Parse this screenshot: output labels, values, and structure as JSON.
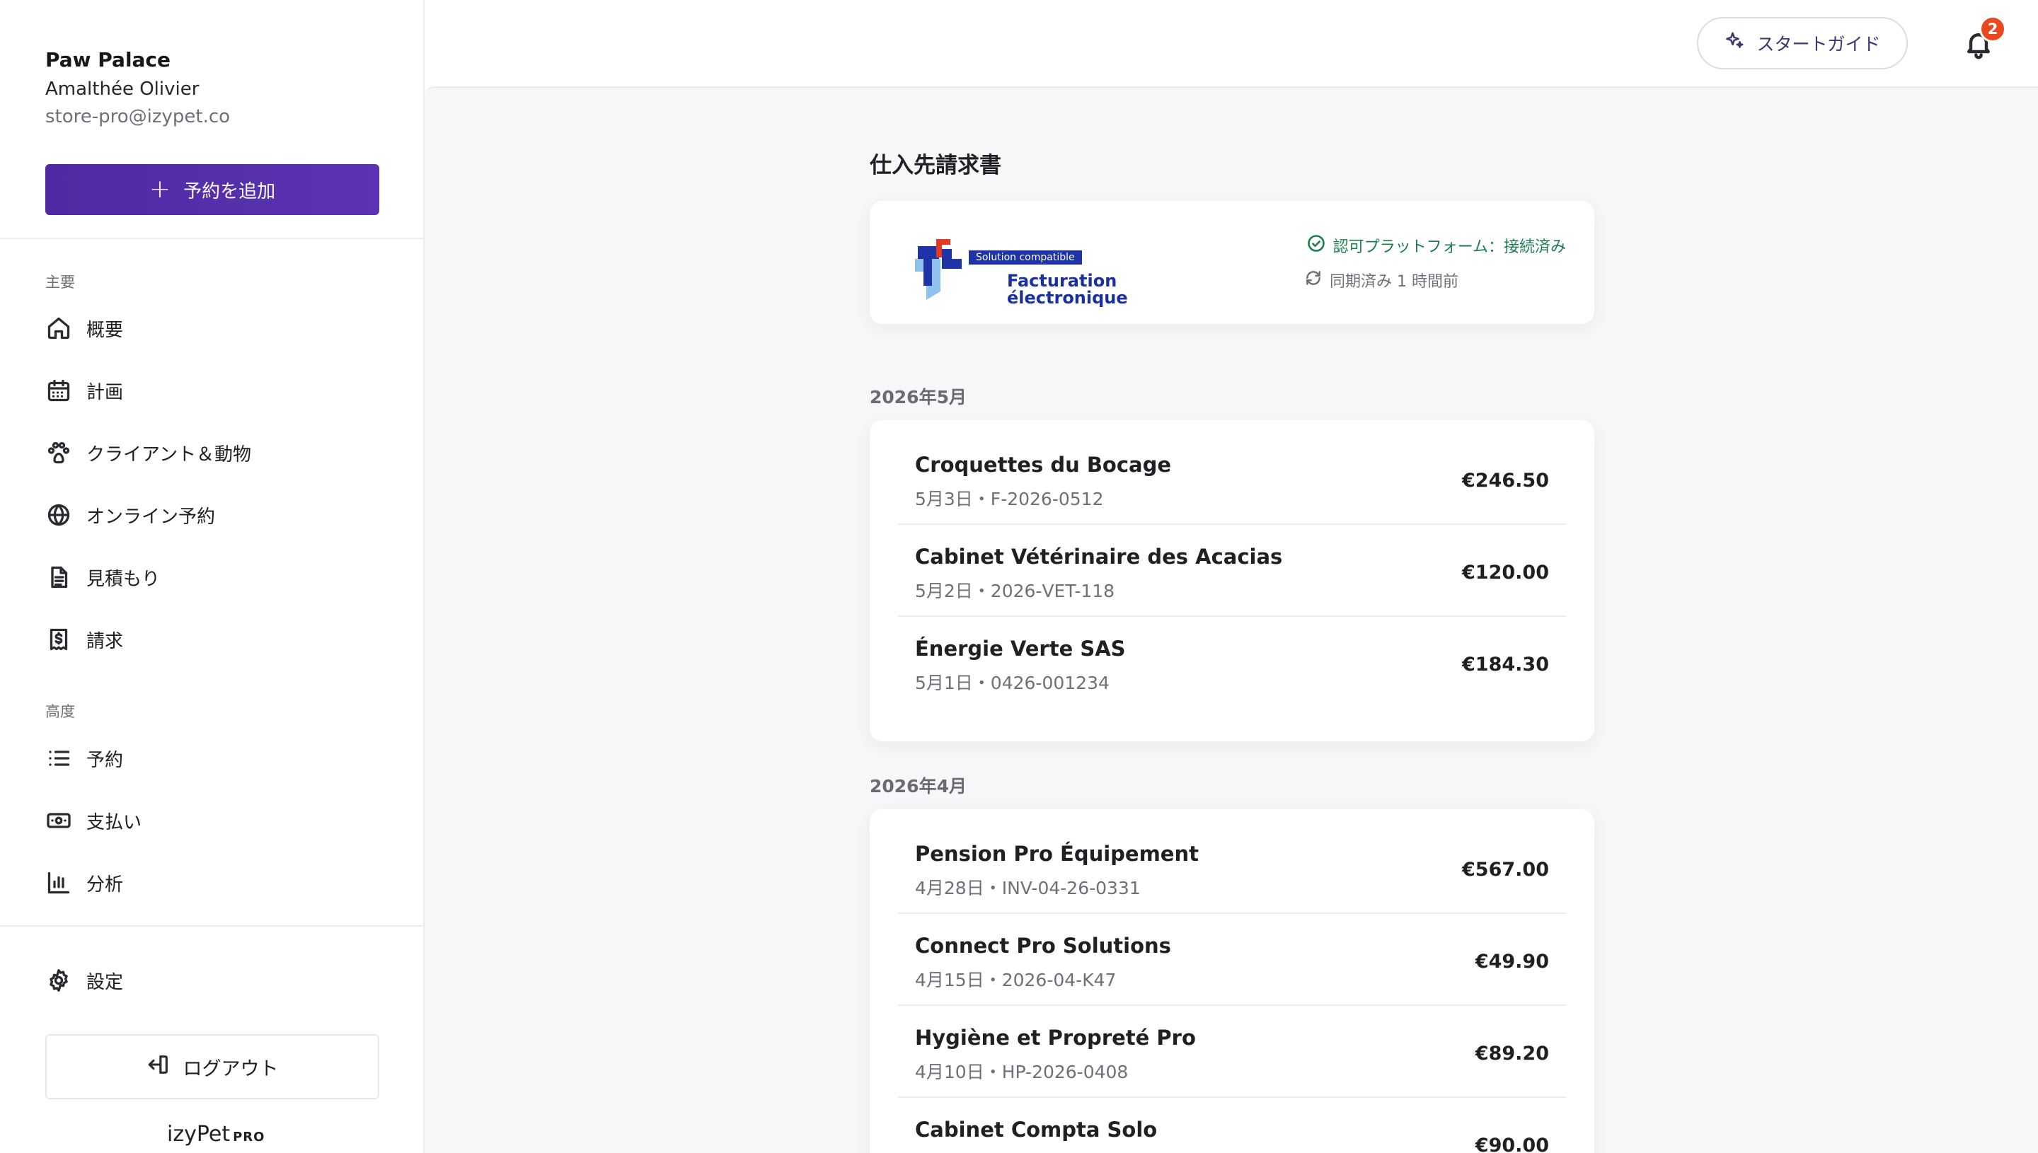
{
  "sidebar": {
    "business_name": "Paw Palace",
    "owner": "Amalthée Olivier",
    "email": "store-pro@izypet.co",
    "add_button": "予約を追加",
    "section_main": "主要",
    "section_advanced": "高度",
    "items_main": [
      {
        "label": "概要",
        "icon": "home-icon"
      },
      {
        "label": "計画",
        "icon": "calendar-icon"
      },
      {
        "label": "クライアント＆動物",
        "icon": "paw-icon"
      },
      {
        "label": "オンライン予約",
        "icon": "globe-icon"
      },
      {
        "label": "見積もり",
        "icon": "document-icon"
      },
      {
        "label": "請求",
        "icon": "invoice-dollar-icon"
      }
    ],
    "items_advanced": [
      {
        "label": "予約",
        "icon": "list-icon"
      },
      {
        "label": "支払い",
        "icon": "cash-icon"
      },
      {
        "label": "分析",
        "icon": "bar-chart-icon"
      }
    ],
    "settings": "設定",
    "logout": "ログアウト",
    "brand": "izyPet",
    "brand_suffix": "PRO"
  },
  "topbar": {
    "guide_button": "スタートガイド",
    "notification_count": "2"
  },
  "main": {
    "title": "仕入先請求書",
    "einvoice": {
      "tag": "Solution compatible",
      "line1": "Facturation",
      "line2": "électronique",
      "status": "認可プラットフォーム：接続済み",
      "sync": "同期済み 1 時間前",
      "colors": {
        "blue": "#1f33a8",
        "red": "#e5391f",
        "light_blue": "#8fc1ee"
      }
    },
    "groups": [
      {
        "month": "2026年5月",
        "invoices": [
          {
            "name": "Croquettes du Bocage",
            "meta": "5月3日・F-2026-0512",
            "amount": "€246.50"
          },
          {
            "name": "Cabinet Vétérinaire des Acacias",
            "meta": "5月2日・2026-VET-118",
            "amount": "€120.00"
          },
          {
            "name": "Énergie Verte SAS",
            "meta": "5月1日・0426-001234",
            "amount": "€184.30"
          }
        ]
      },
      {
        "month": "2026年4月",
        "invoices": [
          {
            "name": "Pension Pro Équipement",
            "meta": "4月28日・INV-04-26-0331",
            "amount": "€567.00"
          },
          {
            "name": "Connect Pro Solutions",
            "meta": "4月15日・2026-04-K47",
            "amount": "€49.90"
          },
          {
            "name": "Hygiène et Propreté Pro",
            "meta": "4月10日・HP-2026-0408",
            "amount": "€89.20"
          },
          {
            "name": "Cabinet Compta Solo",
            "meta": "",
            "amount": "€90.00"
          }
        ]
      }
    ]
  }
}
